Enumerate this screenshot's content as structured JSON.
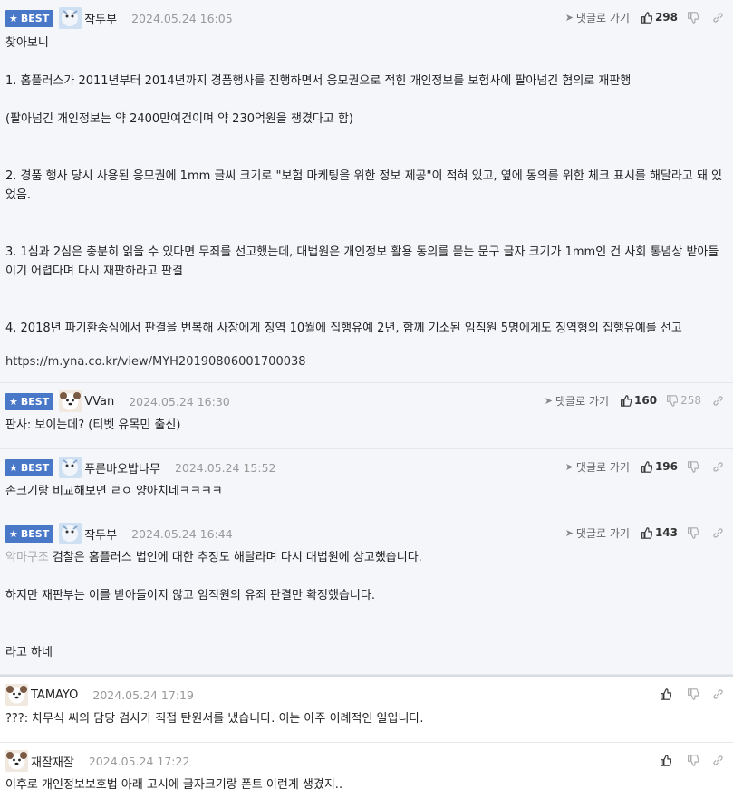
{
  "labels": {
    "best": "BEST",
    "reply": "댓글로 가기"
  },
  "comments": [
    {
      "nick": "작두부",
      "date": "2024.05.24 16:05",
      "up": "298",
      "down": "",
      "lines": [
        "찾아보니",
        "",
        "1. 홈플러스가 2011년부터 2014년까지 경품행사를 진행하면서 응모권으로 적힌 개인정보를 보험사에 팔아넘긴 혐의로 재판행",
        "",
        "(팔아넘긴 개인정보는 약 2400만여건이며 약 230억원을 챙겼다고 함)",
        "",
        "",
        "2. 경품 행사 당시 사용된 응모권에 1mm 글씨 크기로 \"보험 마케팅을 위한 정보 제공\"이 적혀 있고, 옆에 동의를 위한 체크 표시를 해달라고 돼 있었음.",
        "",
        "",
        "3. 1심과 2심은 충분히 읽을 수 있다면 무죄를 선고했는데, 대법원은 개인정보 활용 동의를 묻는 문구 글자 크기가 1mm인 건 사회 통념상 받아들이기 어렵다며 다시 재판하라고 판결",
        "",
        "",
        "4. 2018년 파기환송심에서 판결을 번복해 사장에게 징역 10월에 집행유예 2년, 함께 기소된 임직원 5명에게도 징역형의 집행유예를 선고",
        "",
        "https://m.yna.co.kr/view/MYH20190806001700038"
      ]
    },
    {
      "nick": "VVan",
      "date": "2024.05.24 16:30",
      "up": "160",
      "down": "258",
      "lines": [
        "판사: 보이는데? (티벳 유목민 출신)"
      ]
    },
    {
      "nick": "푸른바오밥나무",
      "date": "2024.05.24 15:52",
      "up": "196",
      "down": "",
      "lines": [
        "손크기랑 비교해보면 ㄹㅇ 양아치네ㅋㅋㅋㅋ"
      ]
    },
    {
      "nick": "작두부",
      "date": "2024.05.24 16:44",
      "up": "143",
      "down": "",
      "mention": "악마구조",
      "lines": [
        "검찰은 홈플러스 법인에 대한 추징도 해달라며 다시 대법원에 상고했습니다.",
        "",
        "하지만 재판부는 이를 받아들이지 않고 임직원의 유죄 판결만 확정했습니다.",
        "",
        "",
        "라고 하네"
      ]
    },
    {
      "nick": "TAMAYO",
      "date": "2024.05.24 17:19",
      "lines": [
        "???: 차무식 씨의 담당 검사가 직접 탄원서를 냈습니다. 이는 아주 이례적인 일입니다."
      ]
    },
    {
      "nick": "재잘재잘",
      "date": "2024.05.24 17:22",
      "lines": [
        "이후로 개인정보보호법 아래 고시에 글자크기랑 폰트 이런게 생겼지.."
      ]
    }
  ]
}
